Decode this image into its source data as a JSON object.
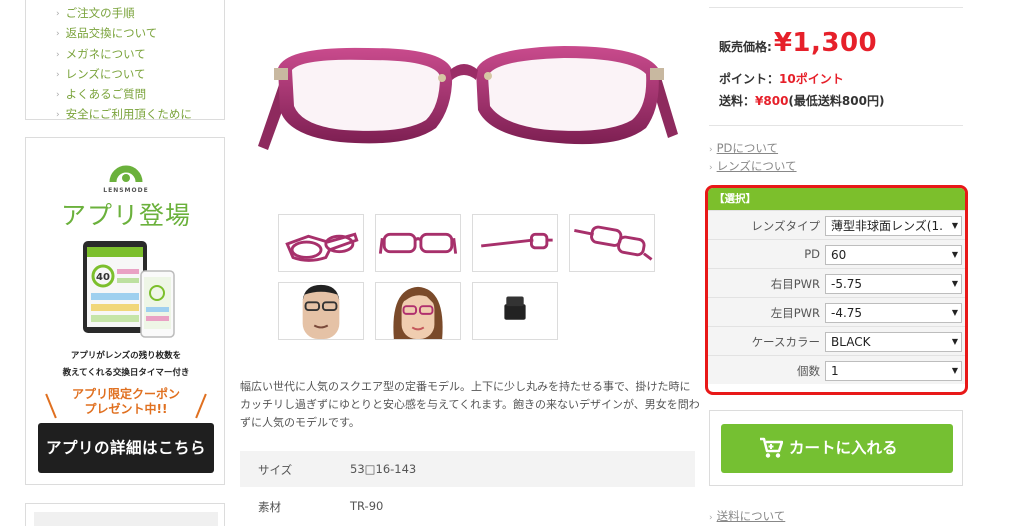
{
  "sidebar": {
    "nav_items": [
      "ご注文の手順",
      "返品交換について",
      "メガネについて",
      "レンズについて",
      "よくあるご質問",
      "安全にご利用頂くために"
    ],
    "app_promo": {
      "logo_text": "LENSMODE",
      "title": "アプリ登場",
      "phone_counter": "40",
      "description_line1": "アプリがレンズの残り枚数を",
      "description_line2": "教えてくれる交換日タイマー付き",
      "coupon_line1": "アプリ限定クーポン",
      "coupon_line2": "プレゼント中!!",
      "details_button": "アプリの詳細はこちら"
    }
  },
  "product": {
    "description": "幅広い世代に人気のスクエア型の定番モデル。上下に少し丸みを持たせる事で、掛けた時にカッチリし過ぎずにゆとりと安心感を与えてくれます。飽きの来ないデザインが、男女を問わずに人気のモデルです。",
    "specs": [
      {
        "label": "サイズ",
        "value": "53□16-143"
      },
      {
        "label": "素材",
        "value": "TR-90"
      }
    ],
    "frame_color": "#b0306e"
  },
  "purchase": {
    "price_label": "販売価格:",
    "price_value": "¥1,300",
    "point_label": "ポイント：",
    "point_value": "10ポイント",
    "shipping_label": "送料：",
    "shipping_value": "¥800",
    "shipping_note": "(最低送料800円)",
    "links": [
      "PDについて",
      "レンズについて"
    ],
    "select_header": "【選択】",
    "options": [
      {
        "label": "レンズタイプ",
        "value": "薄型非球面レンズ(1."
      },
      {
        "label": "PD",
        "value": "60"
      },
      {
        "label": "右目PWR",
        "value": "-5.75"
      },
      {
        "label": "左目PWR",
        "value": "-4.75"
      },
      {
        "label": "ケースカラー",
        "value": "BLACK"
      },
      {
        "label": "個数",
        "value": "1"
      }
    ],
    "cart_button": "カートに入れる",
    "shipping_link": "送料について"
  },
  "colors": {
    "accent_green": "#7cbf2c",
    "price_red": "#e6202a",
    "highlight_red": "#e81818"
  }
}
